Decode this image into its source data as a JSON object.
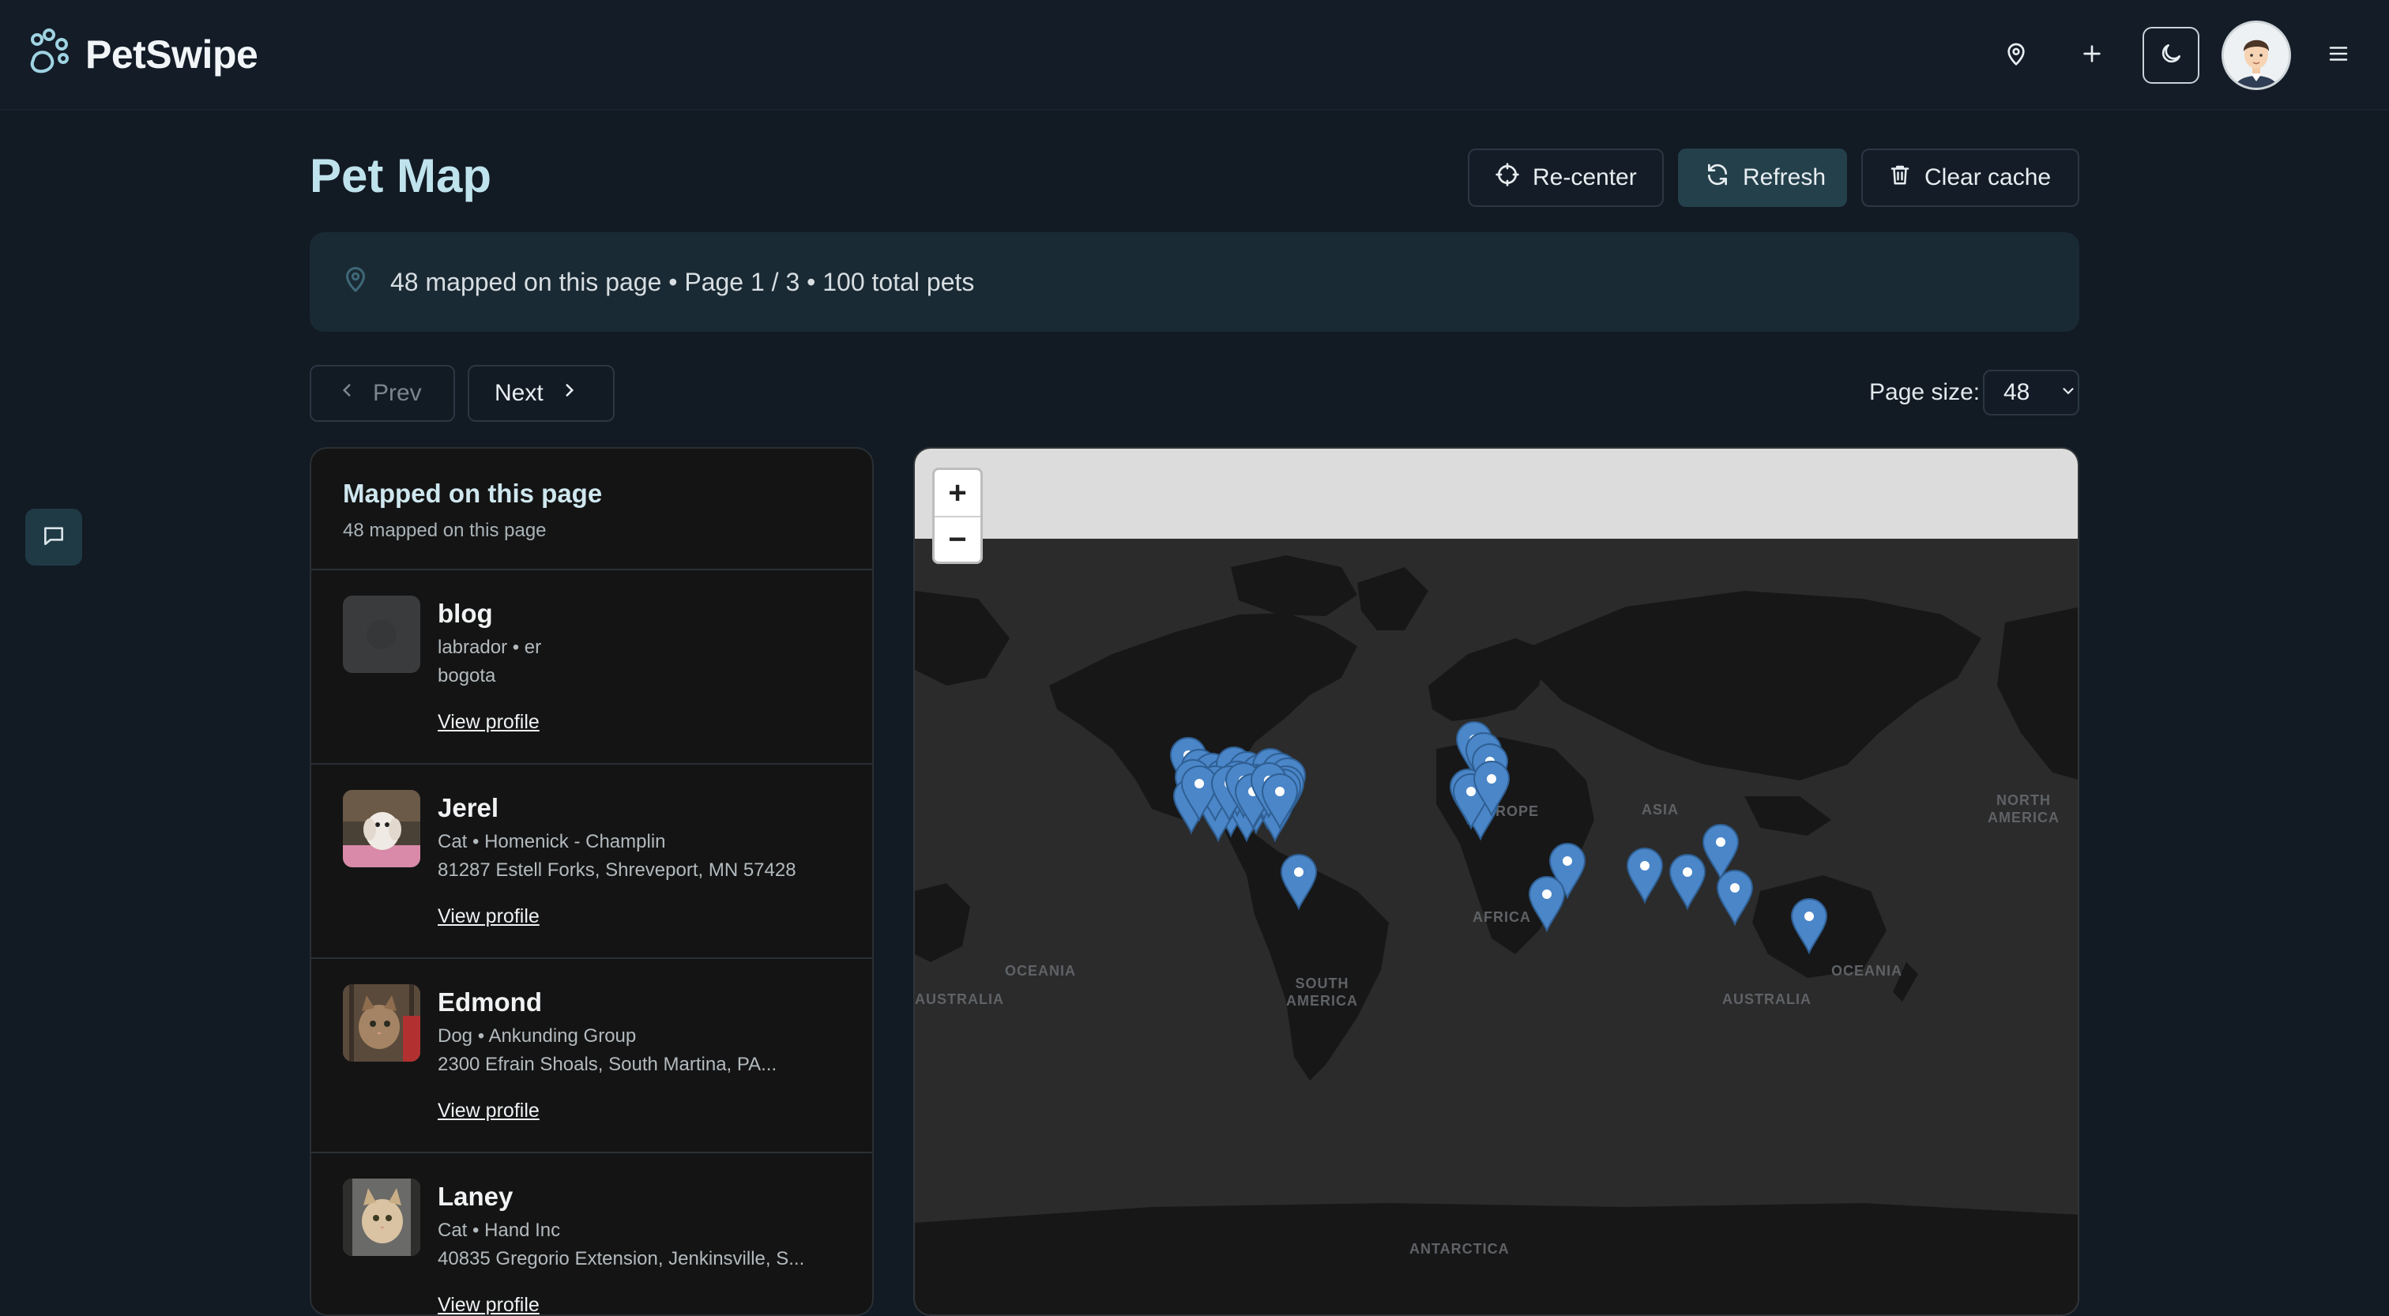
{
  "app": {
    "name": "PetSwipe"
  },
  "nav": {
    "location_icon": "map-pin-icon",
    "add_icon": "plus-icon",
    "theme_icon": "moon-icon",
    "menu_icon": "hamburger-icon"
  },
  "page": {
    "title": "Pet Map",
    "actions": {
      "recenter": "Re-center",
      "refresh": "Refresh",
      "clear_cache": "Clear cache"
    },
    "info": "48 mapped on this page • Page 1 / 3 • 100 total pets",
    "pagination": {
      "prev": "Prev",
      "next": "Next"
    },
    "page_size": {
      "label": "Page size:",
      "value": "48"
    }
  },
  "list": {
    "title": "Mapped on this page",
    "subtitle": "48 mapped on this page",
    "items": [
      {
        "name": "blog",
        "meta": "labrador • er",
        "address": "bogota",
        "link": "View profile"
      },
      {
        "name": "Jerel",
        "meta": "Cat • Homenick - Champlin",
        "address": "81287 Estell Forks, Shreveport, MN 57428",
        "link": "View profile"
      },
      {
        "name": "Edmond",
        "meta": "Dog • Ankunding Group",
        "address": "2300 Efrain Shoals, South Martina, PA...",
        "link": "View profile"
      },
      {
        "name": "Laney",
        "meta": "Cat • Hand Inc",
        "address": "40835 Gregorio Extension, Jenkinsville, S...",
        "link": "View profile"
      }
    ]
  },
  "map": {
    "zoom_in": "+",
    "zoom_out": "−",
    "labels": {
      "oceania_left": "OCEANIA",
      "australia_left": "AUSTRALIA",
      "south_america": "SOUTH\nAMERICA",
      "africa": "AFRICA",
      "europe": "EUROPE",
      "asia": "ASIA",
      "north_america": "NORTH\nAMERICA",
      "oceania_right": "OCEANIA",
      "australia_right": "AUSTRALIA",
      "antarctica": "ANTARCTICA"
    },
    "marker_color": "#4a86c8"
  },
  "colors": {
    "background": "#121a24",
    "accent": "#bfe3ec",
    "primary_button": "#24404b"
  }
}
